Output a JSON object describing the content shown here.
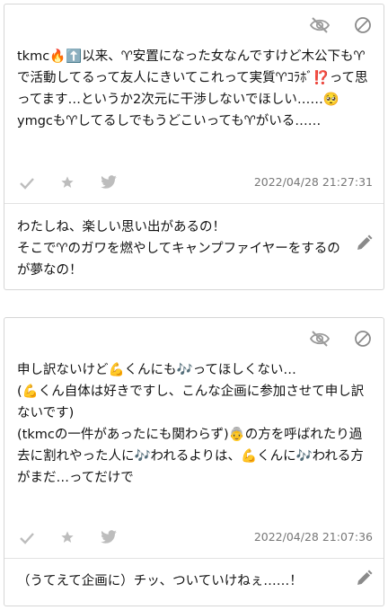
{
  "icons": {
    "hide": "eye-slash-icon",
    "block": "ban-icon",
    "check": "check-icon",
    "star": "star-icon",
    "twitter": "twitter-bird-icon",
    "edit": "pencil-icon"
  },
  "colors": {
    "icon": "#bdbdbd",
    "icon_dark": "#8a8a8a",
    "border": "#d6d6d6",
    "timestamp": "#777777"
  },
  "cards": [
    {
      "message": "tkmc🔥⬆️以来、♈安置になった女なんですけど木公下も♈で活動してるって友人にきいてこれって実質♈ｺﾗﾎﾞ⁉️って思ってます…というか2次元に干渉しないでほしい……🥺\nymgcも♈してるしでもうどこいっても♈がいる……",
      "timestamp": "2022/04/28 21:27:31",
      "answer": "わたしね、楽しい思い出があるの！\nそこで♈のガワを燃やしてキャンプファイヤーをするのが夢なの！"
    },
    {
      "message": "申し訳ないけど💪くんにも🎶ってほしくない…\n(💪くん自体は好きですし、こんな企画に参加させて申し訳ないです)\n(tkmcの一件があったにも関わらず)👵の方を呼ばれたり過去に割れやった人に🎶われるよりは、💪くんに🎶われる方がまだ…ってだけで",
      "timestamp": "2022/04/28 21:07:36",
      "answer": "（うてえて企画に）チッ、ついていけねぇ……！"
    }
  ]
}
